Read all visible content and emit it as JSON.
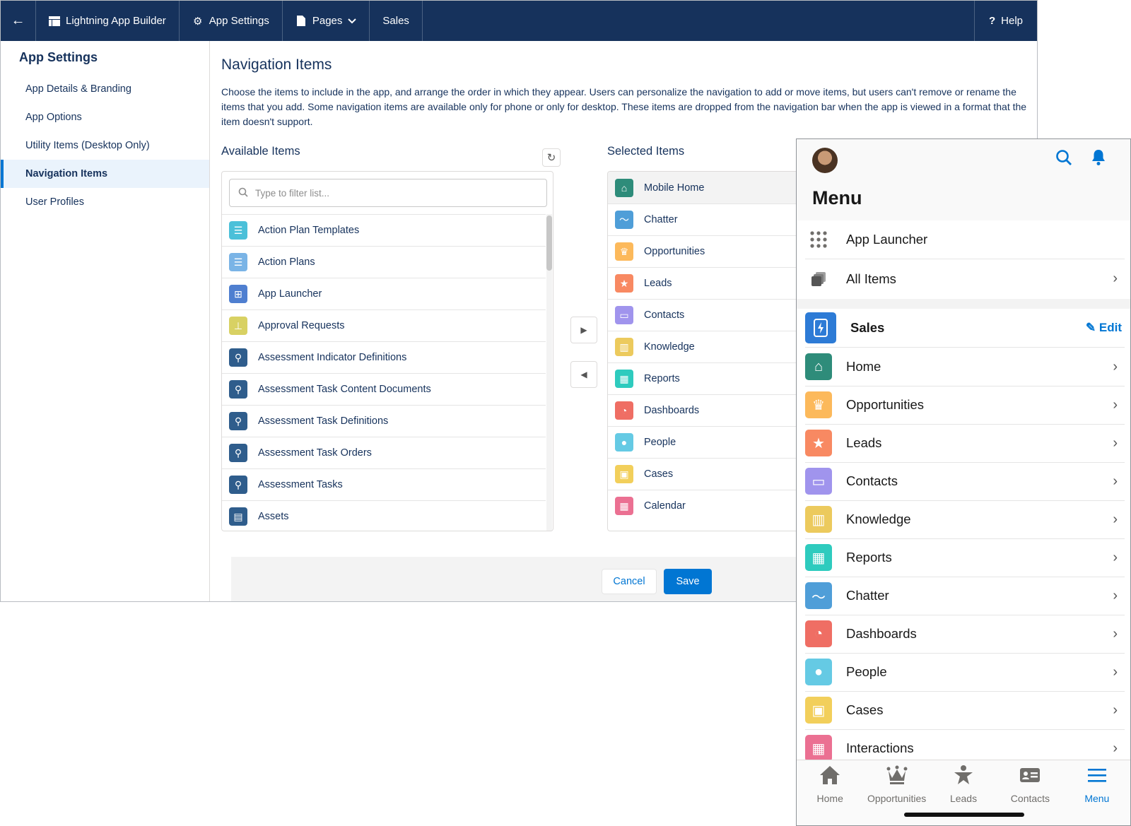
{
  "topbar": {
    "back_icon": "arrow-left-icon",
    "builder_label": "Lightning App Builder",
    "settings_label": "App Settings",
    "pages_label": "Pages",
    "app_name": "Sales",
    "help_label": "Help"
  },
  "sidebar": {
    "title": "App Settings",
    "items": [
      {
        "label": "App Details & Branding"
      },
      {
        "label": "App Options"
      },
      {
        "label": "Utility Items (Desktop Only)"
      },
      {
        "label": "Navigation Items"
      },
      {
        "label": "User Profiles"
      }
    ],
    "active": "Navigation Items"
  },
  "main": {
    "title": "Navigation Items",
    "description": "Choose the items to include in the app, and arrange the order in which they appear. Users can personalize the navigation to add or move items, but users can't remove or rename the items that you add. Some navigation items are available only for phone or only for desktop. These items are dropped from the navigation bar when the app is viewed in a format that the item doesn't support.",
    "available_title": "Available Items",
    "selected_title": "Selected Items",
    "filter_placeholder": "Type to filter list...",
    "available_items": [
      {
        "label": "Action Plan Templates",
        "icon": "checklist-icon",
        "color": "#4bc0d9"
      },
      {
        "label": "Action Plans",
        "icon": "checklist-icon",
        "color": "#7ab4e6"
      },
      {
        "label": "App Launcher",
        "icon": "app-launcher-icon",
        "color": "#4f7fd0"
      },
      {
        "label": "Approval Requests",
        "icon": "approval-icon",
        "color": "#d8d163"
      },
      {
        "label": "Assessment Indicator Definitions",
        "icon": "assessment-icon",
        "color": "#2f5d8c"
      },
      {
        "label": "Assessment Task Content Documents",
        "icon": "assessment-icon",
        "color": "#2f5d8c"
      },
      {
        "label": "Assessment Task Definitions",
        "icon": "assessment-icon",
        "color": "#2f5d8c"
      },
      {
        "label": "Assessment Task Orders",
        "icon": "assessment-icon",
        "color": "#2f5d8c"
      },
      {
        "label": "Assessment Tasks",
        "icon": "assessment-icon",
        "color": "#2f5d8c"
      },
      {
        "label": "Assets",
        "icon": "asset-icon",
        "color": "#2f5d8c"
      }
    ],
    "selected_items": [
      {
        "label": "Mobile Home",
        "icon": "home-icon",
        "color": "#2e8c7a"
      },
      {
        "label": "Chatter",
        "icon": "chatter-icon",
        "color": "#4f9ed8"
      },
      {
        "label": "Opportunities",
        "icon": "crown-icon",
        "color": "#fcb95b"
      },
      {
        "label": "Leads",
        "icon": "lead-icon",
        "color": "#f88962"
      },
      {
        "label": "Contacts",
        "icon": "contact-card-icon",
        "color": "#a094ed"
      },
      {
        "label": "Knowledge",
        "icon": "book-icon",
        "color": "#ecca5d"
      },
      {
        "label": "Reports",
        "icon": "report-icon",
        "color": "#2ecbbe"
      },
      {
        "label": "Dashboards",
        "icon": "dashboard-icon",
        "color": "#ef6e64"
      },
      {
        "label": "People",
        "icon": "person-icon",
        "color": "#65cae4"
      },
      {
        "label": "Cases",
        "icon": "briefcase-icon",
        "color": "#f2cf5b"
      },
      {
        "label": "Calendar",
        "icon": "calendar-icon",
        "color": "#eb7092"
      }
    ],
    "cancel_label": "Cancel",
    "save_label": "Save"
  },
  "phone": {
    "menu_title": "Menu",
    "app_launcher_label": "App Launcher",
    "all_items_label": "All Items",
    "app_label": "Sales",
    "edit_label": "Edit",
    "items": [
      {
        "label": "Home",
        "icon": "home-icon",
        "color": "#2e8c7a"
      },
      {
        "label": "Opportunities",
        "icon": "crown-icon",
        "color": "#fcb95b"
      },
      {
        "label": "Leads",
        "icon": "lead-icon",
        "color": "#f88962"
      },
      {
        "label": "Contacts",
        "icon": "contact-card-icon",
        "color": "#a094ed"
      },
      {
        "label": "Knowledge",
        "icon": "book-icon",
        "color": "#ecca5d"
      },
      {
        "label": "Reports",
        "icon": "report-icon",
        "color": "#2ecbbe"
      },
      {
        "label": "Chatter",
        "icon": "chatter-icon",
        "color": "#4f9ed8"
      },
      {
        "label": "Dashboards",
        "icon": "dashboard-icon",
        "color": "#ef6e64"
      },
      {
        "label": "People",
        "icon": "person-icon",
        "color": "#65cae4"
      },
      {
        "label": "Cases",
        "icon": "briefcase-icon",
        "color": "#f2cf5b"
      },
      {
        "label": "Interactions",
        "icon": "calendar-icon",
        "color": "#eb7092"
      }
    ],
    "tabs": [
      {
        "label": "Home",
        "icon": "home-icon"
      },
      {
        "label": "Opportunities",
        "icon": "crown-icon"
      },
      {
        "label": "Leads",
        "icon": "lead-icon"
      },
      {
        "label": "Contacts",
        "icon": "contact-card-icon"
      },
      {
        "label": "Menu",
        "icon": "hamburger-icon"
      }
    ],
    "active_tab": "Menu"
  },
  "colors": {
    "header_bg": "#16325c",
    "brand_blue": "#0176d3",
    "active_nav_bg": "#eaf3fc"
  }
}
